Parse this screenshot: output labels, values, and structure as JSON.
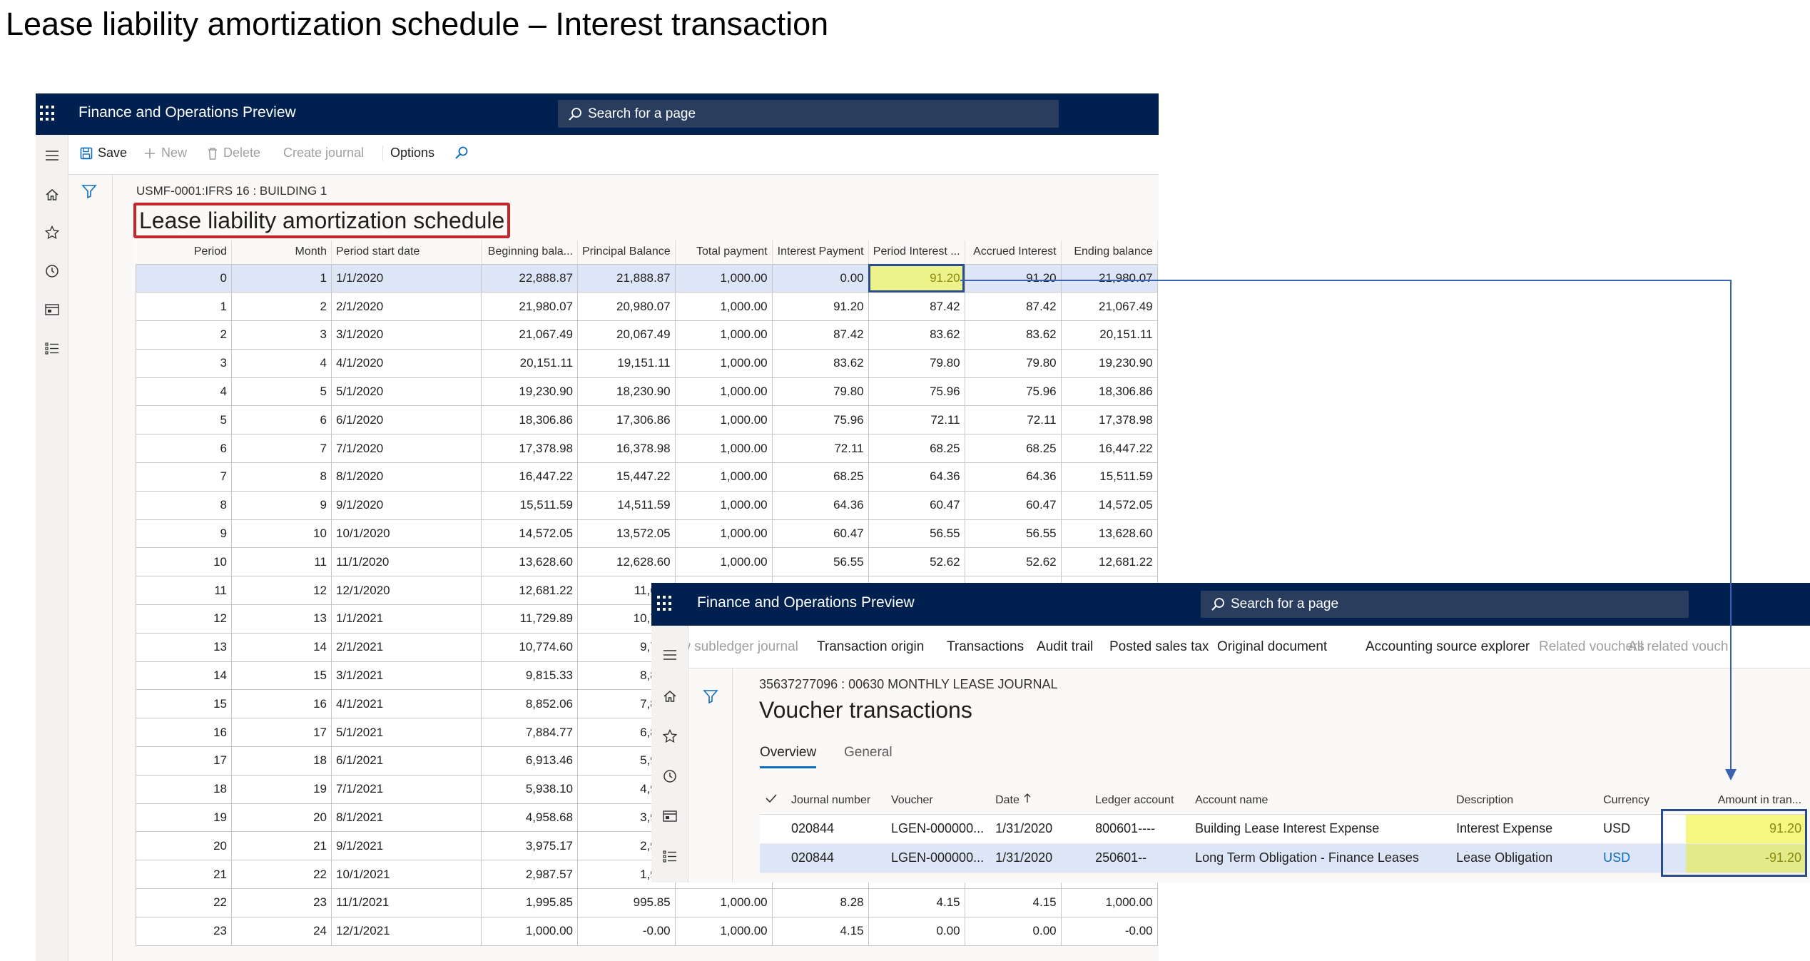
{
  "slide_title": "Lease liability amortization schedule – Interest transaction",
  "window1": {
    "app_title": "Finance and Operations Preview",
    "search_placeholder": "Search for a page",
    "actions": {
      "save": "Save",
      "new": "New",
      "delete": "Delete",
      "create_journal": "Create journal",
      "options": "Options"
    },
    "caption": "USMF-0001:IFRS 16 : BUILDING 1",
    "page_title": "Lease liability amortization schedule",
    "columns": [
      "Period",
      "Month",
      "Period start date",
      "Beginning bala...",
      "Principal Balance",
      "Total payment",
      "Interest Payment",
      "Period Interest ...",
      "Accrued Interest",
      "Ending balance"
    ],
    "rows": [
      [
        "0",
        "1",
        "1/1/2020",
        "22,888.87",
        "21,888.87",
        "1,000.00",
        "0.00",
        "91.20",
        "91.20",
        "21,980.07"
      ],
      [
        "1",
        "2",
        "2/1/2020",
        "21,980.07",
        "20,980.07",
        "1,000.00",
        "91.20",
        "87.42",
        "87.42",
        "21,067.49"
      ],
      [
        "2",
        "3",
        "3/1/2020",
        "21,067.49",
        "20,067.49",
        "1,000.00",
        "87.42",
        "83.62",
        "83.62",
        "20,151.11"
      ],
      [
        "3",
        "4",
        "4/1/2020",
        "20,151.11",
        "19,151.11",
        "1,000.00",
        "83.62",
        "79.80",
        "79.80",
        "19,230.90"
      ],
      [
        "4",
        "5",
        "5/1/2020",
        "19,230.90",
        "18,230.90",
        "1,000.00",
        "79.80",
        "75.96",
        "75.96",
        "18,306.86"
      ],
      [
        "5",
        "6",
        "6/1/2020",
        "18,306.86",
        "17,306.86",
        "1,000.00",
        "75.96",
        "72.11",
        "72.11",
        "17,378.98"
      ],
      [
        "6",
        "7",
        "7/1/2020",
        "17,378.98",
        "16,378.98",
        "1,000.00",
        "72.11",
        "68.25",
        "68.25",
        "16,447.22"
      ],
      [
        "7",
        "8",
        "8/1/2020",
        "16,447.22",
        "15,447.22",
        "1,000.00",
        "68.25",
        "64.36",
        "64.36",
        "15,511.59"
      ],
      [
        "8",
        "9",
        "9/1/2020",
        "15,511.59",
        "14,511.59",
        "1,000.00",
        "64.36",
        "60.47",
        "60.47",
        "14,572.05"
      ],
      [
        "9",
        "10",
        "10/1/2020",
        "14,572.05",
        "13,572.05",
        "1,000.00",
        "60.47",
        "56.55",
        "56.55",
        "13,628.60"
      ],
      [
        "10",
        "11",
        "11/1/2020",
        "13,628.60",
        "12,628.60",
        "1,000.00",
        "56.55",
        "52.62",
        "52.62",
        "12,681.22"
      ],
      [
        "11",
        "12",
        "12/1/2020",
        "12,681.22",
        "11,681",
        "",
        "",
        "",
        "",
        ""
      ],
      [
        "12",
        "13",
        "1/1/2021",
        "11,729.89",
        "10,729",
        "",
        "",
        "",
        "",
        ""
      ],
      [
        "13",
        "14",
        "2/1/2021",
        "10,774.60",
        "9,774",
        "",
        "",
        "",
        "",
        ""
      ],
      [
        "14",
        "15",
        "3/1/2021",
        "9,815.33",
        "8,815",
        "",
        "",
        "",
        "",
        ""
      ],
      [
        "15",
        "16",
        "4/1/2021",
        "8,852.06",
        "7,852",
        "",
        "",
        "",
        "",
        ""
      ],
      [
        "16",
        "17",
        "5/1/2021",
        "7,884.77",
        "6,884",
        "",
        "",
        "",
        "",
        ""
      ],
      [
        "17",
        "18",
        "6/1/2021",
        "6,913.46",
        "5,913",
        "",
        "",
        "",
        "",
        ""
      ],
      [
        "18",
        "19",
        "7/1/2021",
        "5,938.10",
        "4,938",
        "",
        "",
        "",
        "",
        ""
      ],
      [
        "19",
        "20",
        "8/1/2021",
        "4,958.68",
        "3,958",
        "",
        "",
        "",
        "",
        ""
      ],
      [
        "20",
        "21",
        "9/1/2021",
        "3,975.17",
        "2,975",
        "",
        "",
        "",
        "",
        ""
      ],
      [
        "21",
        "22",
        "10/1/2021",
        "2,987.57",
        "1,987",
        "",
        "",
        "",
        "",
        ""
      ],
      [
        "22",
        "23",
        "11/1/2021",
        "1,995.85",
        "995.85",
        "1,000.00",
        "8.28",
        "4.15",
        "4.15",
        "1,000.00"
      ],
      [
        "23",
        "24",
        "12/1/2021",
        "1,000.00",
        "-0.00",
        "1,000.00",
        "4.15",
        "0.00",
        "0.00",
        "-0.00"
      ]
    ]
  },
  "window2": {
    "app_title": "Finance and Operations Preview",
    "search_placeholder": "Search for a page",
    "actions": [
      "View subledger journal",
      "Transaction origin",
      "Transactions",
      "Audit trail",
      "Posted sales tax",
      "Original document",
      "Accounting source explorer",
      "Related vouchers",
      "All related vouch"
    ],
    "caption": "35637277096 : 00630 MONTHLY LEASE JOURNAL",
    "page_title": "Voucher transactions",
    "tabs": [
      "Overview",
      "General"
    ],
    "columns": [
      "Journal number",
      "Voucher",
      "Date",
      "Ledger account",
      "Account name",
      "Description",
      "Currency",
      "Amount in tran..."
    ],
    "rows": [
      [
        "020844",
        "LGEN-000000...",
        "1/31/2020",
        "800601----",
        "Building Lease Interest Expense",
        "Interest Expense",
        "USD",
        "91.20"
      ],
      [
        "020844",
        "LGEN-000000...",
        "1/31/2020",
        "250601--",
        "Long Term Obligation - Finance Leases",
        "Lease Obligation",
        "USD",
        "-91.20"
      ]
    ]
  },
  "colors": {
    "nav_bar": "#002050",
    "highlight_yellow": "#eef28a",
    "selection_blue": "#dde6f6",
    "title_box_red": "#c4262e",
    "connector_blue": "#3a62b3"
  },
  "icons": [
    "app-launcher-icon",
    "search-icon",
    "save-icon",
    "plus-icon",
    "trash-icon",
    "find-icon",
    "hamburger-icon",
    "home-icon",
    "star-icon",
    "clock-icon",
    "workspace-icon",
    "list-icon",
    "filter-icon",
    "checkmark-icon",
    "sort-ascending-icon"
  ]
}
